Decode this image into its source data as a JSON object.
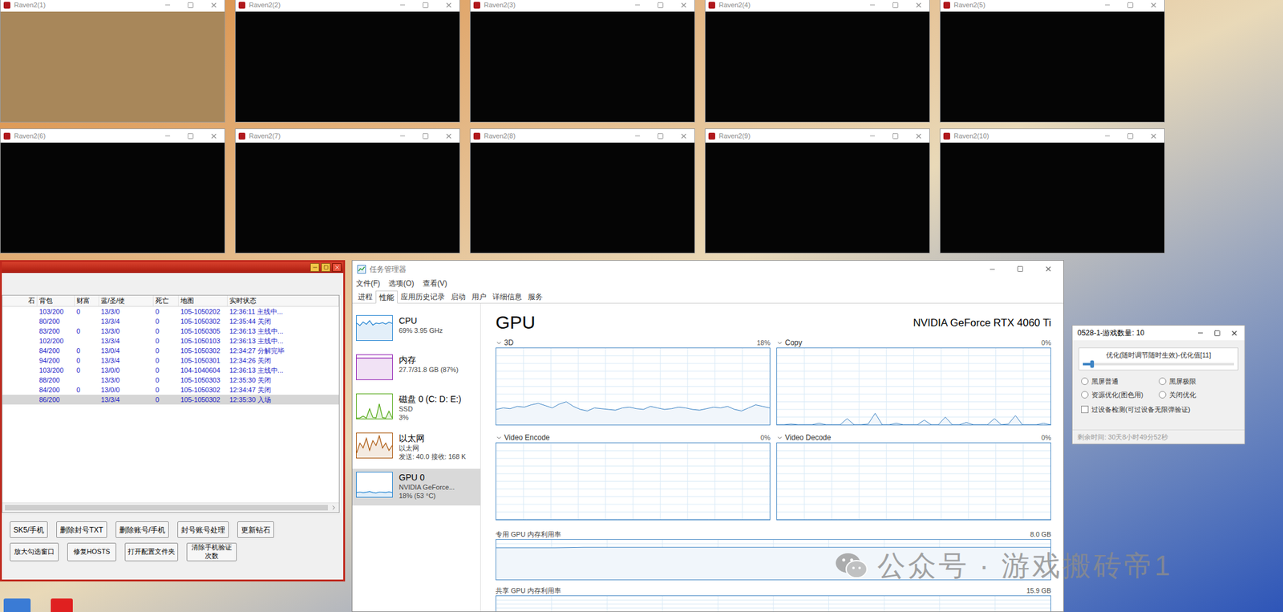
{
  "game_windows": [
    {
      "title": "Raven2(1)",
      "color": "#a8875a"
    },
    {
      "title": "Raven2(2)",
      "color": "#050505"
    },
    {
      "title": "Raven2(3)",
      "color": "#050505"
    },
    {
      "title": "Raven2(4)",
      "color": "#050505"
    },
    {
      "title": "Raven2(5)",
      "color": "#050505"
    },
    {
      "title": "Raven2(6)",
      "color": "#050505"
    },
    {
      "title": "Raven2(7)",
      "color": "#050505"
    },
    {
      "title": "Raven2(8)",
      "color": "#050505"
    },
    {
      "title": "Raven2(9)",
      "color": "#050505"
    },
    {
      "title": "Raven2(10)",
      "color": "#050505"
    }
  ],
  "tool_window": {
    "columns": [
      "石",
      "背包",
      "财富",
      "蓝/圣/使",
      "死亡",
      "地图",
      "实时状态"
    ],
    "rows": [
      {
        "cells": [
          "",
          "103/200",
          "0",
          "13/3/0",
          "0",
          "105-1050202",
          "12:36:11 主线中..."
        ],
        "selected": false
      },
      {
        "cells": [
          "",
          "80/200",
          "",
          "13/3/4",
          "0",
          "105-1050302",
          "12:35:44 关闭"
        ],
        "selected": false
      },
      {
        "cells": [
          "",
          "83/200",
          "0",
          "13/3/0",
          "0",
          "105-1050305",
          "12:36:13 主线中..."
        ],
        "selected": false
      },
      {
        "cells": [
          "",
          "102/200",
          "",
          "13/3/4",
          "0",
          "105-1050103",
          "12:36:13 主线中..."
        ],
        "selected": false
      },
      {
        "cells": [
          "",
          "84/200",
          "0",
          "13/0/4",
          "0",
          "105-1050302",
          "12:34:27 分解完毕"
        ],
        "selected": false
      },
      {
        "cells": [
          "",
          "94/200",
          "0",
          "13/3/4",
          "0",
          "105-1050301",
          "12:34:26 关闭"
        ],
        "selected": false
      },
      {
        "cells": [
          "",
          "103/200",
          "0",
          "13/0/0",
          "0",
          "104-1040604",
          "12:36:13 主线中..."
        ],
        "selected": false
      },
      {
        "cells": [
          "",
          "88/200",
          "",
          "13/3/0",
          "0",
          "105-1050303",
          "12:35:30 关闭"
        ],
        "selected": false
      },
      {
        "cells": [
          "",
          "84/200",
          "0",
          "13/0/0",
          "0",
          "105-1050302",
          "12:34:47 关闭"
        ],
        "selected": false
      },
      {
        "cells": [
          "",
          "86/200",
          "",
          "13/3/4",
          "0",
          "105-1050302",
          "12:35:30 入场"
        ],
        "selected": true
      }
    ],
    "buttons_row1": [
      "SK5/手机",
      "删除封号TXT",
      "删除账号/手机",
      "封号账号处理",
      "更新钻石"
    ],
    "buttons_row2": [
      "放大勾选窗口",
      "修复HOSTS",
      "打开配置文件夹",
      "清除手机验证次数"
    ]
  },
  "task_manager": {
    "title": "任务管理器",
    "menu": [
      "文件(F)",
      "选项(O)",
      "查看(V)"
    ],
    "tabs": [
      {
        "label": "进程",
        "selected": false
      },
      {
        "label": "性能",
        "selected": true
      },
      {
        "label": "应用历史记录",
        "selected": false
      },
      {
        "label": "启动",
        "selected": false
      },
      {
        "label": "用户",
        "selected": false
      },
      {
        "label": "详细信息",
        "selected": false
      },
      {
        "label": "服务",
        "selected": false
      }
    ],
    "sidebar": [
      {
        "title": "CPU",
        "lines": [
          "69% 3.95 GHz"
        ],
        "selected": false,
        "color": "#1a7fd0",
        "values": [
          70,
          60,
          75,
          65,
          80,
          62,
          70,
          68,
          72,
          66,
          74,
          69
        ]
      },
      {
        "title": "内存",
        "lines": [
          "27.7/31.8 GB (87%)"
        ],
        "selected": false,
        "color": "#8b12ae",
        "values": [
          87,
          87,
          87,
          87,
          87,
          87,
          87,
          87,
          87,
          87,
          87,
          87
        ]
      },
      {
        "title": "磁盘 0 (C: D: E:)",
        "lines": [
          "SSD",
          "3%"
        ],
        "selected": false,
        "color": "#4da60c",
        "values": [
          2,
          3,
          10,
          2,
          40,
          5,
          3,
          60,
          4,
          2,
          30,
          3
        ]
      },
      {
        "title": "以太网",
        "lines": [
          "以太网",
          "发送: 40.0 接收: 168 K"
        ],
        "selected": false,
        "color": "#a74f01",
        "values": [
          20,
          60,
          40,
          80,
          30,
          70,
          50,
          90,
          40,
          60,
          30,
          50
        ]
      },
      {
        "title": "GPU 0",
        "lines": [
          "NVIDIA GeForce...",
          "18% (53 °C)"
        ],
        "selected": true,
        "color": "#1a7fd0",
        "values": [
          18,
          20,
          17,
          19,
          22,
          18,
          16,
          20,
          19,
          18,
          21,
          18
        ]
      }
    ],
    "heading": "GPU",
    "device": "NVIDIA GeForce RTX 4060 Ti",
    "charts": [
      {
        "label": "3D",
        "reading": "18%",
        "values": [
          20,
          22,
          21,
          24,
          23,
          26,
          28,
          25,
          22,
          27,
          30,
          24,
          20,
          18,
          22,
          21,
          20,
          19,
          22,
          23,
          21,
          20,
          24,
          22,
          20,
          21,
          23,
          22,
          20,
          19,
          21,
          23,
          22,
          24,
          20,
          18,
          22,
          26,
          24,
          22
        ]
      },
      {
        "label": "Copy",
        "reading": "0%",
        "values": [
          0,
          0,
          1,
          0,
          0,
          0,
          2,
          0,
          0,
          0,
          8,
          0,
          0,
          1,
          15,
          0,
          0,
          2,
          0,
          0,
          0,
          6,
          0,
          0,
          10,
          0,
          0,
          3,
          0,
          0,
          0,
          8,
          0,
          1,
          12,
          0,
          0,
          0,
          2,
          0
        ]
      },
      {
        "label": "Video Encode",
        "reading": "0%",
        "values": [
          0,
          0,
          0,
          0,
          0,
          0,
          0,
          0,
          0,
          0
        ]
      },
      {
        "label": "Video Decode",
        "reading": "0%",
        "values": [
          0,
          0,
          0,
          0,
          0,
          0,
          0,
          0,
          0,
          0
        ]
      }
    ],
    "memory_charts": [
      {
        "label": "专用 GPU 内存利用率",
        "reading": "8.0 GB",
        "values": [
          80,
          80,
          80,
          81,
          81,
          81,
          81,
          81,
          81,
          81,
          81,
          81,
          81,
          81,
          81,
          81,
          81,
          81,
          81,
          81
        ]
      },
      {
        "label": "共享 GPU 内存利用率",
        "reading": "15.9 GB",
        "values": []
      }
    ]
  },
  "optimizer": {
    "title": "0528-1-游戏数量: 10",
    "slider_label": "优化(随时调节随时生效)-优化值[11]",
    "level": 0.05,
    "radios": [
      {
        "label": "黑屏普通",
        "selected": false
      },
      {
        "label": "黑屏极限",
        "selected": false
      },
      {
        "label": "资源优化(图色用)",
        "selected": false
      },
      {
        "label": "关闭优化",
        "selected": false
      }
    ],
    "checkbox": {
      "label": "过设备检测(可过设备无限弹验证)",
      "checked": false
    },
    "footer": "剩余时间: 30天8小时49分52秒"
  },
  "watermark": "公众号 · 游戏搬砖帝1"
}
